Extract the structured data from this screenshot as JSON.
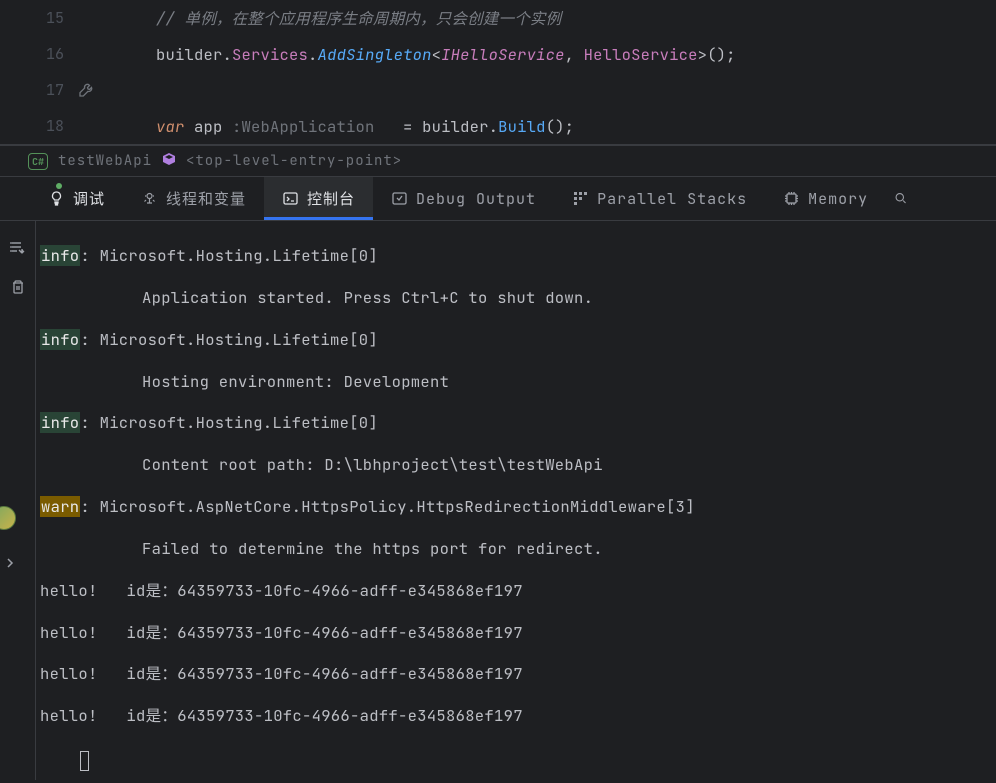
{
  "editor": {
    "lines": [
      {
        "num": "15"
      },
      {
        "num": "16"
      },
      {
        "num": "17"
      },
      {
        "num": "18"
      }
    ],
    "line15_comment": "// 单例，在整个应用程序生命周期内，只会创建一个实例",
    "line16": {
      "builder": "builder",
      "services": "Services",
      "method": "AddSingleton",
      "lt": "<",
      "t1": "IHelloService",
      "comma": ", ",
      "t2": "HelloService",
      "gt": ">",
      "paren": "();"
    },
    "line18": {
      "var": "var",
      "app": " app",
      "hint": " :WebApplication ",
      "eq": "  = ",
      "builder": "builder",
      "build": "Build",
      "paren": "();"
    }
  },
  "breadcrumb": {
    "badge": "C#",
    "project": "testWebApi",
    "entry": "<top-level-entry-point>"
  },
  "tabs": {
    "debug": "调试",
    "threads": "线程和变量",
    "console": "控制台",
    "debugOutput": "Debug Output",
    "parallel": "Parallel Stacks",
    "memory": "Memory"
  },
  "console": {
    "entries": [
      {
        "tag": "info",
        "src": ": Microsoft.Hosting.Lifetime[0]",
        "msg": "Application started. Press Ctrl+C to shut down."
      },
      {
        "tag": "info",
        "src": ": Microsoft.Hosting.Lifetime[0]",
        "msg": "Hosting environment: Development"
      },
      {
        "tag": "info",
        "src": ": Microsoft.Hosting.Lifetime[0]",
        "msg": "Content root path: D:\\lbhproject\\test\\testWebApi"
      },
      {
        "tag": "warn",
        "src": ": Microsoft.AspNetCore.HttpsPolicy.HttpsRedirectionMiddleware[3]",
        "msg": "Failed to determine the https port for redirect."
      }
    ],
    "hello_lines": [
      "hello!   id是：64359733-10fc-4966-adff-e345868ef197",
      "hello!   id是：64359733-10fc-4966-adff-e345868ef197",
      "hello!   id是：64359733-10fc-4966-adff-e345868ef197",
      "hello!   id是：64359733-10fc-4966-adff-e345868ef197"
    ]
  }
}
